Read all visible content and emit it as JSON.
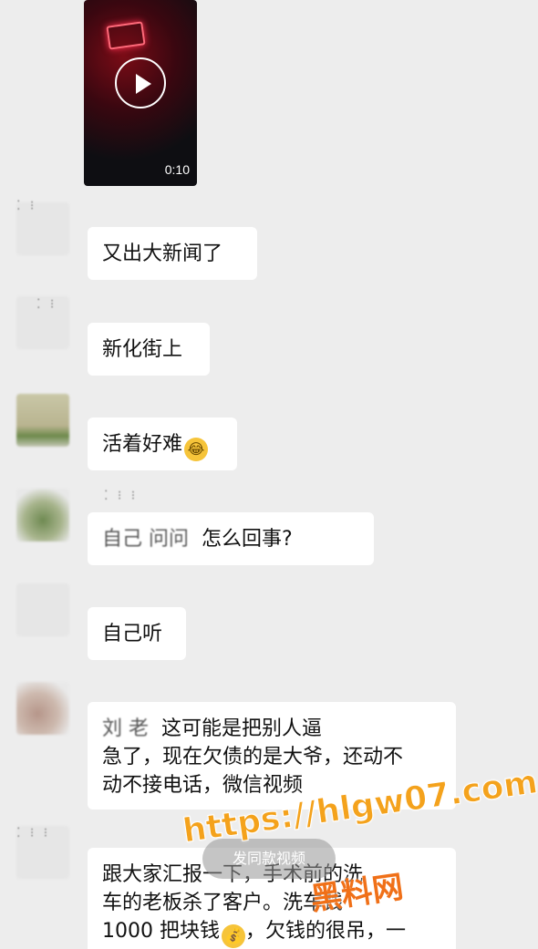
{
  "video": {
    "duration": "0:10"
  },
  "messages": [
    {
      "text": "又出大新闻了"
    },
    {
      "text": "新化街上"
    },
    {
      "text": "活着好难",
      "emoji": "crying-laughing-emoji"
    },
    {
      "obscured_text": "自己  问问",
      "text": "怎么回事?"
    },
    {
      "text": "自己听"
    },
    {
      "obscured_text": "刘  老",
      "text_line1": "这可能是把别人逼",
      "text_line2": "急了，现在欠债的是大爷，还动不",
      "text_line3": "动不接电话，微信视频"
    },
    {
      "text_line1": "跟大家汇报一下，手术前的洗",
      "text_line2": "车的老板杀了客户。洗车钱",
      "text_line3": "1000 把块钱",
      "text_line3b": "，欠钱的很吊，一"
    }
  ],
  "overlay": {
    "pill_label": "发同款视频"
  },
  "watermark": {
    "url": "https://hlgw07.com",
    "cn": "黑料网"
  },
  "colors": {
    "background": "#ededed",
    "bubble": "#ffffff",
    "watermark_orange": "#f4a21c"
  }
}
